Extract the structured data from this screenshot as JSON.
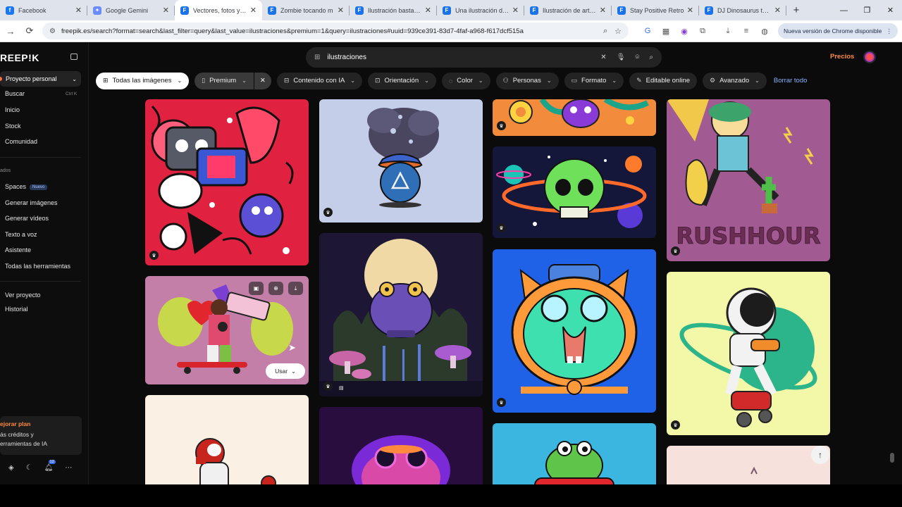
{
  "browser": {
    "tabs": [
      {
        "title": "Facebook",
        "favicon_color": "#1877f2",
        "favicon_glyph": "f",
        "active": false
      },
      {
        "title": "Google Gemini",
        "favicon_color": "#6b8cff",
        "favicon_glyph": "✦",
        "active": false
      },
      {
        "title": "Vectores, fotos y ar",
        "favicon_color": "#1a73e8",
        "favicon_glyph": "F",
        "active": true
      },
      {
        "title": "Zombie tocando m",
        "favicon_color": "#1a73e8",
        "favicon_glyph": "F",
        "active": false
      },
      {
        "title": "Ilustración bastardo",
        "favicon_color": "#1a73e8",
        "favicon_glyph": "F",
        "active": false
      },
      {
        "title": "Una ilustración de c",
        "favicon_color": "#1a73e8",
        "favicon_glyph": "F",
        "active": false
      },
      {
        "title": "Ilustración de arte v",
        "favicon_color": "#1a73e8",
        "favicon_glyph": "F",
        "active": false
      },
      {
        "title": "Stay Positive Retro",
        "favicon_color": "#1a73e8",
        "favicon_glyph": "F",
        "active": false
      },
      {
        "title": "DJ Dinosaurus toca",
        "favicon_color": "#1a73e8",
        "favicon_glyph": "F",
        "active": false
      }
    ],
    "url": "freepik.es/search?format=search&last_filter=query&last_value=ilustraciones&premium=1&query=ilustraciones#uuid=939ce391-83d7-4faf-a968-f617dcf515a",
    "update_label": "Nueva versión de Chrome disponible"
  },
  "sidebar": {
    "logo": "REEP!K",
    "project": "Proyecto personal",
    "nav": [
      {
        "label": "Buscar",
        "shortcut": "Ctrl K"
      },
      {
        "label": "Inicio"
      },
      {
        "label": "Stock"
      },
      {
        "label": "Comunidad"
      }
    ],
    "section_label": "ados",
    "tools": [
      {
        "label": "Spaces",
        "badge": "Nuevo"
      },
      {
        "label": "Generar imágenes"
      },
      {
        "label": "Generar vídeos"
      },
      {
        "label": "Texto a voz"
      },
      {
        "label": "Asistente"
      },
      {
        "label": "Todas las herramientas"
      }
    ],
    "footer_links": [
      {
        "label": "Ver proyecto"
      },
      {
        "label": "Historial"
      }
    ],
    "upgrade": {
      "title": "ejorar plan",
      "line1": "ás créditos y",
      "line2": "erramientas de IA"
    },
    "notification_count": "12"
  },
  "header": {
    "search_query": "ilustraciones",
    "pricing_label": "Precios"
  },
  "filters": {
    "all_images": "Todas las imágenes",
    "premium": "Premium",
    "ai_content": "Contenido con IA",
    "orientation": "Orientación",
    "color": "Color",
    "people": "Personas",
    "format": "Formato",
    "editable": "Editable online",
    "advanced": "Avanzado",
    "clear_all": "Borrar todo"
  },
  "results": {
    "use_button": "Usar"
  },
  "colors": {
    "accent": "#ff8a3d",
    "link": "#8ab4ff",
    "background": "#0b0b0b",
    "chip": "#232323"
  }
}
